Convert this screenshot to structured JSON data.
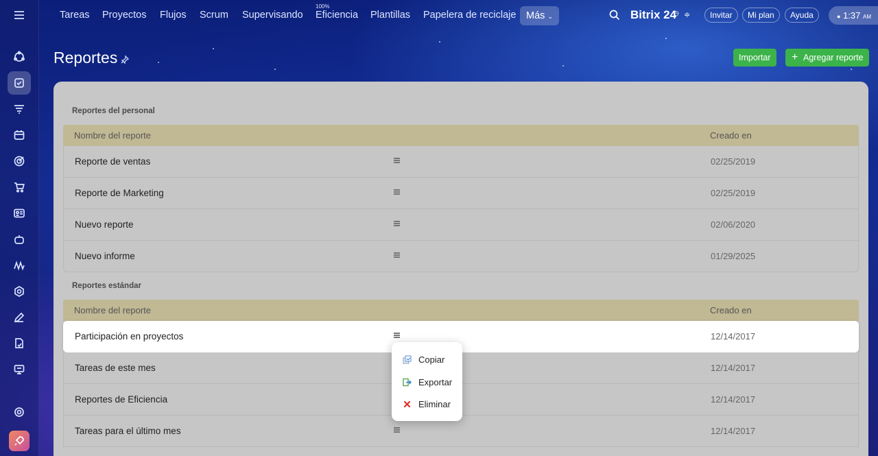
{
  "nav": {
    "items": [
      "Tareas",
      "Proyectos",
      "Flujos",
      "Scrum",
      "Supervisando",
      "Eficiencia",
      "Plantillas",
      "Papelera de reciclaje"
    ],
    "efficiency_badge": "100%",
    "more_label": "Más",
    "brand": "Bitrix 24",
    "invite_label": "Invitar",
    "plan_label": "Mi plan",
    "help_label": "Ayuda",
    "time": "1:37",
    "time_suffix": "AM"
  },
  "sidebar": {
    "icons": [
      "activity-icon",
      "tasks-icon",
      "funnel-icon",
      "calendar-icon",
      "target-icon",
      "cart-icon",
      "contact-card-icon",
      "robot-icon",
      "signature-icon",
      "hexagon-icon",
      "pen-icon",
      "document-sign-icon",
      "presentation-icon",
      "gear-icon",
      "rocket-icon"
    ],
    "active": "tasks-icon"
  },
  "header": {
    "title": "Reportes",
    "import_label": "Importar",
    "add_label": "Agregar reporte"
  },
  "personal": {
    "label": "Reportes del personal",
    "col_name": "Nombre del reporte",
    "col_created": "Creado en",
    "rows": [
      {
        "name": "Reporte de ventas",
        "date": "02/25/2019"
      },
      {
        "name": "Reporte de Marketing",
        "date": "02/25/2019"
      },
      {
        "name": "Nuevo reporte",
        "date": "02/06/2020"
      },
      {
        "name": "Nuevo informe",
        "date": "01/29/2025"
      }
    ]
  },
  "standard": {
    "label": "Reportes estándar",
    "col_name": "Nombre del reporte",
    "col_created": "Creado en",
    "rows": [
      {
        "name": "Participación en proyectos",
        "date": "12/14/2017"
      },
      {
        "name": "Tareas de este mes",
        "date": "12/14/2017"
      },
      {
        "name": "Reportes de Eficiencia",
        "date": "12/14/2017"
      },
      {
        "name": "Tareas para el último mes",
        "date": "12/14/2017"
      }
    ]
  },
  "context_menu": {
    "copy": "Copiar",
    "export": "Exportar",
    "delete": "Eliminar"
  },
  "colors": {
    "accent_green": "#3cb34a",
    "table_header": "#c1b894",
    "delete_red": "#e0302a"
  }
}
